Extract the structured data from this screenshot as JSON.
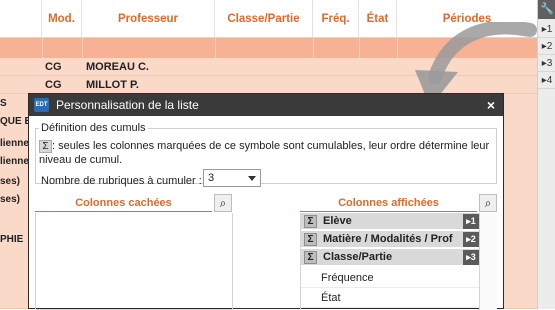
{
  "background": {
    "columns": [
      "Mod.",
      "Professeur",
      "Classe/Partie",
      "Fréq.",
      "État",
      "Périodes"
    ],
    "rows": [
      {
        "mod": "CG",
        "prof": "MOREAU C."
      },
      {
        "mod": "CG",
        "prof": "MILLOT P."
      }
    ],
    "left_fragments": [
      "S",
      "QUE E",
      "lienne",
      "lienne",
      "ses)",
      "ses)",
      "PHIE"
    ],
    "right_numbers": [
      "1",
      "2",
      "3",
      "4"
    ],
    "accent_color": "#e06a2a"
  },
  "dialog": {
    "logo_text": "EDT",
    "title": "Personnalisation de la liste",
    "close_symbol": "×",
    "section_title": "Définition des cumuls",
    "sigma_symbol": "Σ",
    "info_text": ": seules les colonnes marquées de ce symbole sont cumulables, leur ordre détermine leur niveau de cumul.",
    "count_label": "Nombre de rubriques à cumuler :",
    "count_value": "3",
    "hidden_header": "Colonnes cachées",
    "shown_header": "Colonnes affichées",
    "shown_columns": [
      {
        "label": "Elève",
        "order": "1"
      },
      {
        "label": "Matière / Modalités / Prof",
        "order": "2"
      },
      {
        "label": "Classe/Partie",
        "order": "3"
      }
    ],
    "plain_columns": [
      "Fréquence",
      "État"
    ]
  }
}
